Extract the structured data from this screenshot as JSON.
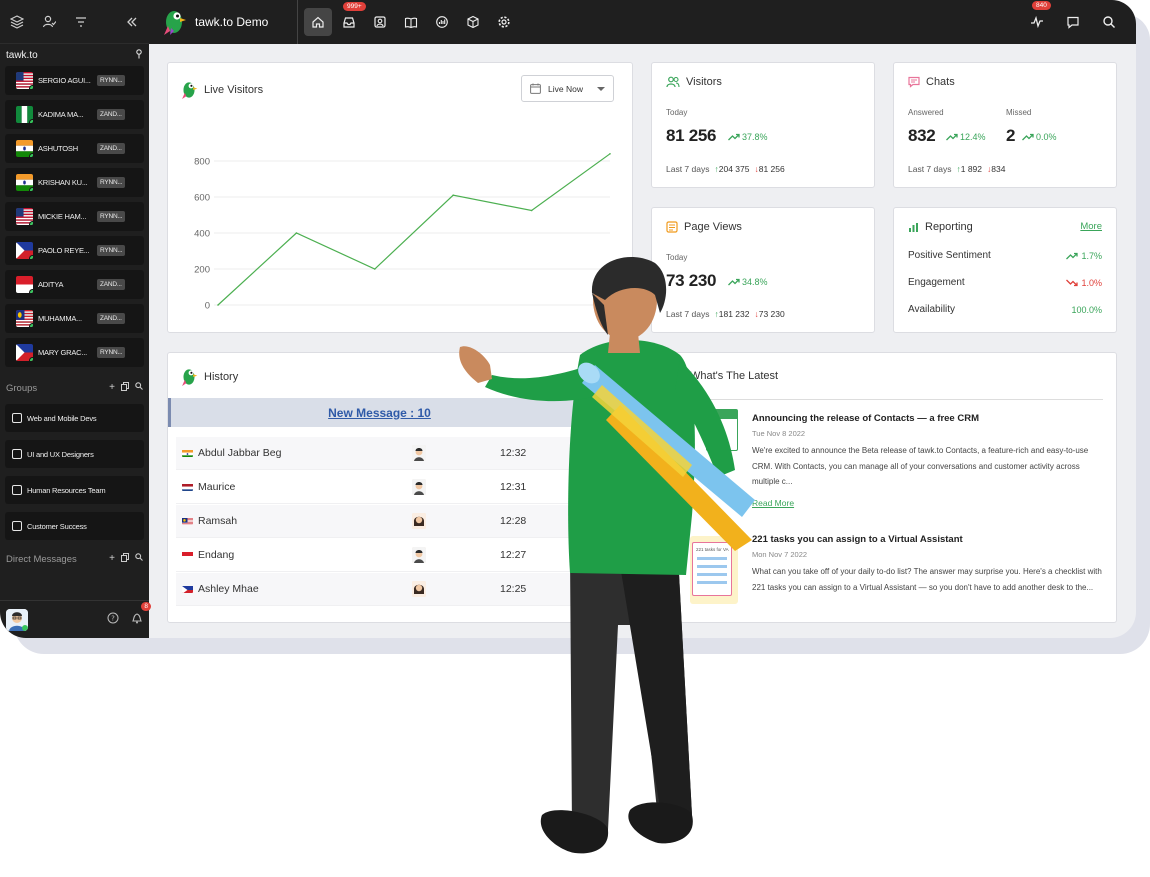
{
  "sidebar": {
    "property": "tawk.to",
    "visitors": [
      {
        "name": "SERGIO AGUI...",
        "tag": "RYNN...",
        "flag": "us"
      },
      {
        "name": "KADIMA MA...",
        "tag": "ZAND...",
        "flag": "ng"
      },
      {
        "name": "ASHUTOSH",
        "tag": "ZAND...",
        "flag": "in"
      },
      {
        "name": "KRISHAN KU...",
        "tag": "RYNN...",
        "flag": "in"
      },
      {
        "name": "MICKIE HAM...",
        "tag": "RYNN...",
        "flag": "us"
      },
      {
        "name": "PAOLO REYE...",
        "tag": "RYNN...",
        "flag": "ph"
      },
      {
        "name": "ADITYA",
        "tag": "ZAND...",
        "flag": "id"
      },
      {
        "name": "MUHAMMA...",
        "tag": "ZAND...",
        "flag": "my"
      },
      {
        "name": "MARY GRAC...",
        "tag": "RYNN...",
        "flag": "ph"
      }
    ],
    "groups_label": "Groups",
    "groups": [
      "Web and Mobile Devs",
      "UI and UX Designers",
      "Human Resources Team",
      "Customer Success"
    ],
    "dm_label": "Direct Messages",
    "notif_count": "8"
  },
  "topbar": {
    "brand": "tawk.to Demo",
    "inbox_badge": "999+",
    "activity_badge": "840"
  },
  "live_visitors": {
    "title": "Live Visitors",
    "filter": "Live Now"
  },
  "chart_data": {
    "type": "line",
    "x": [
      1,
      2,
      3,
      4,
      5,
      6
    ],
    "y": [
      0,
      400,
      200,
      610,
      525,
      840
    ],
    "ylim": [
      0,
      900
    ],
    "yticks": [
      0,
      200,
      400,
      600,
      800
    ],
    "color": "#4caf50",
    "grid": true
  },
  "visitors": {
    "title": "Visitors",
    "today_label": "Today",
    "today_value": "81 256",
    "today_trend": "37.8%",
    "last7_label": "Last 7 days",
    "last7_up": "204 375",
    "last7_down": "81 256"
  },
  "chats": {
    "title": "Chats",
    "answered_label": "Answered",
    "answered_value": "832",
    "answered_trend": "12.4%",
    "missed_label": "Missed",
    "missed_value": "2",
    "missed_trend": "0.0%",
    "last7_label": "Last 7 days",
    "last7_up": "1 892",
    "last7_down": "834"
  },
  "page_views": {
    "title": "Page Views",
    "today_label": "Today",
    "today_value": "73 230",
    "today_trend": "34.8%",
    "last7_label": "Last 7 days",
    "last7_up": "181 232",
    "last7_down": "73 230"
  },
  "reporting": {
    "title": "Reporting",
    "more": "More",
    "rows": [
      {
        "label": "Positive Sentiment",
        "value": "1.7%",
        "dir": "up"
      },
      {
        "label": "Engagement",
        "value": "1.0%",
        "dir": "down"
      },
      {
        "label": "Availability",
        "value": "100.0%",
        "dir": "none"
      }
    ]
  },
  "history": {
    "title": "History",
    "banner": "New Message : 10",
    "rows": [
      {
        "name": "Abdul Jabbar Beg",
        "time": "12:32",
        "flag": "in",
        "av": "m"
      },
      {
        "name": "Maurice",
        "time": "12:31",
        "flag": "nl",
        "av": "m"
      },
      {
        "name": "Ramsah",
        "time": "12:28",
        "flag": "my",
        "av": "f"
      },
      {
        "name": "Endang",
        "time": "12:27",
        "flag": "id",
        "av": "m"
      },
      {
        "name": "Ashley Mhae",
        "time": "12:25",
        "flag": "ph",
        "av": "f"
      }
    ]
  },
  "latest": {
    "title": "What's The Latest",
    "items": [
      {
        "title": "Announcing the release of Contacts — a free CRM",
        "date": "Tue Nov 8 2022",
        "body": "We're excited to announce the Beta release of tawk.to Contacts, a feature-rich and easy-to-use CRM. With Contacts, you can manage all of your conversations and customer activity across multiple c...",
        "read_more": "Read More"
      },
      {
        "title": "221 tasks you can assign to a Virtual Assistant",
        "date": "Mon Nov 7 2022",
        "body": "What can you take off of your daily to-do list? The answer may surprise you. Here's a checklist with 221 tasks you can assign to a Virtual Assistant — so you don't have to add another desk to the...",
        "thumb_text": "221 tasks for VA"
      }
    ]
  }
}
